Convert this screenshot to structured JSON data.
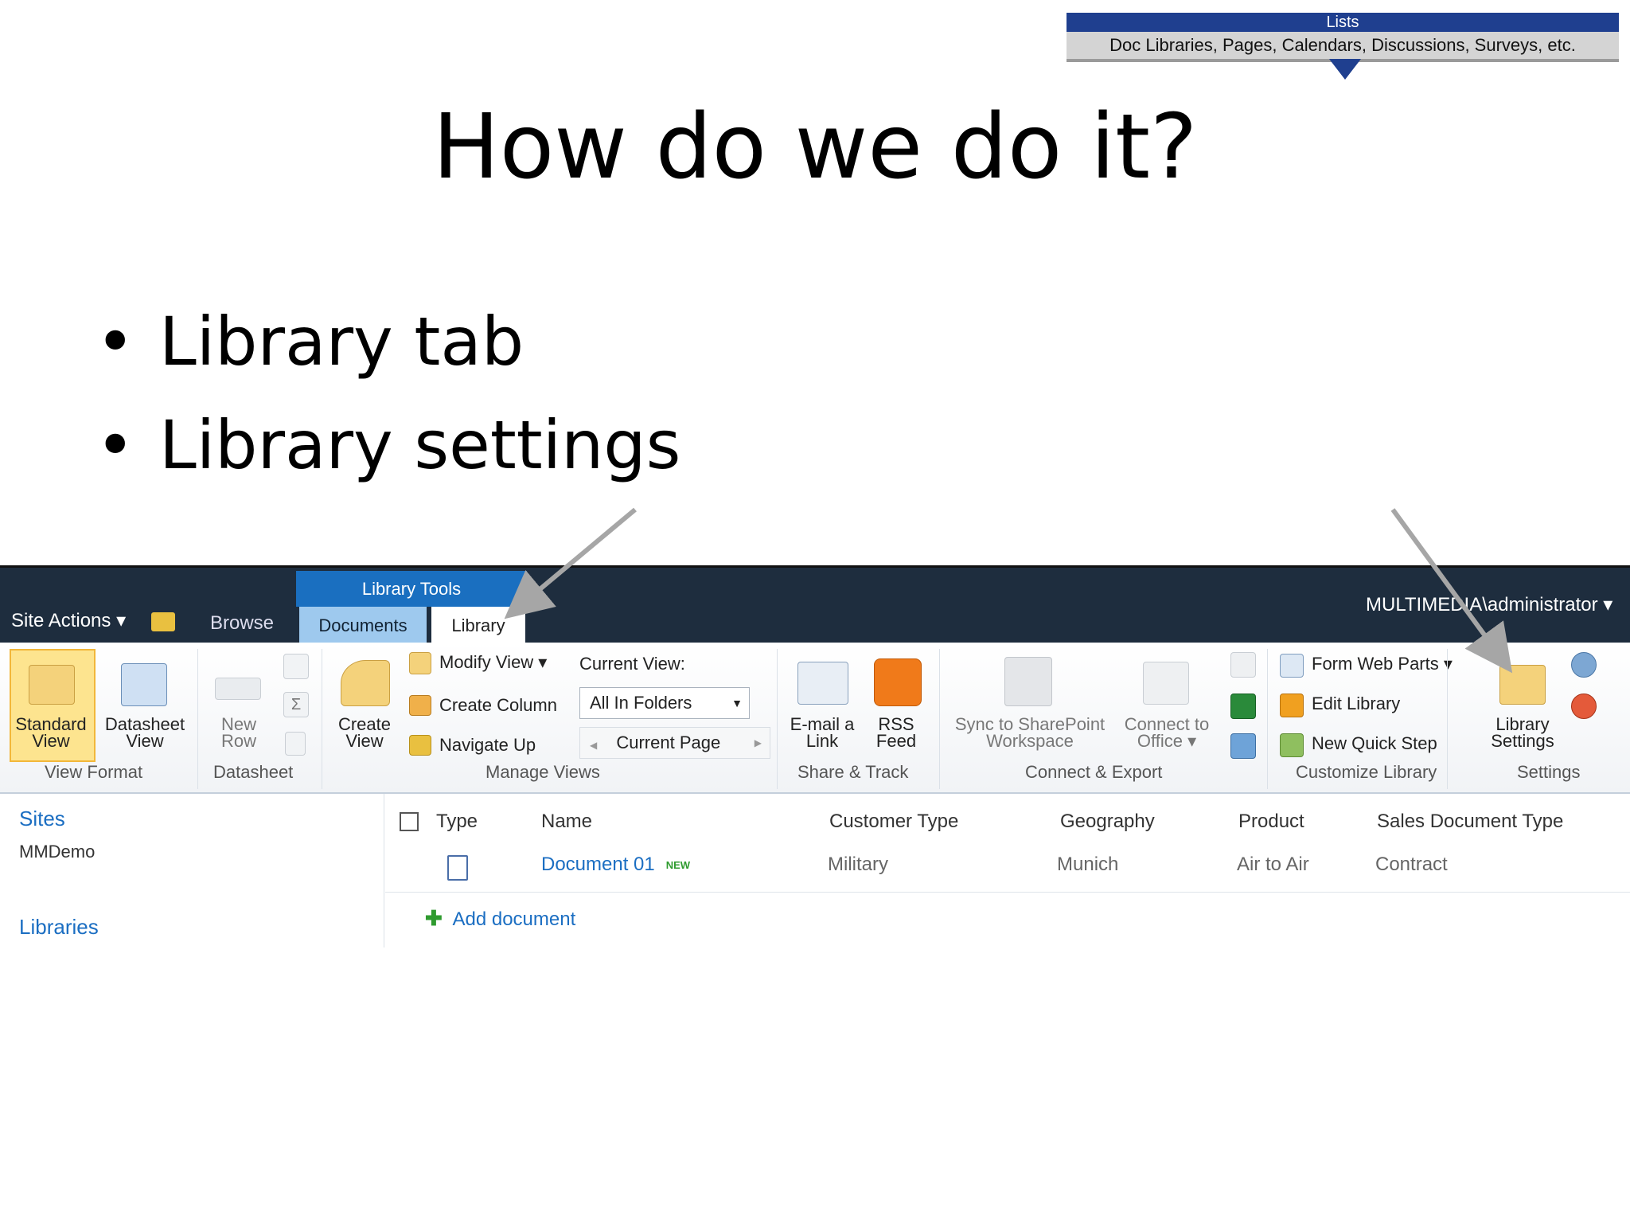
{
  "banner": {
    "title": "Lists",
    "subtitle": "Doc Libraries, Pages, Calendars, Discussions, Surveys, etc."
  },
  "slide": {
    "title": "How do we do it?",
    "bullets": [
      "Library tab",
      "Library settings"
    ],
    "bullet_char": "•"
  },
  "sharepoint": {
    "top_bar": {
      "site_actions": "Site Actions ▾",
      "browse": "Browse",
      "user": "MULTIMEDIA\\administrator ▾",
      "context_tab_group": "Library Tools",
      "tabs": [
        {
          "label": "Documents",
          "active": false
        },
        {
          "label": "Library",
          "active": true
        }
      ]
    },
    "ribbon": {
      "groups": {
        "view_format": "View Format",
        "datasheet": "Datasheet",
        "manage_views": "Manage Views",
        "share_track": "Share & Track",
        "connect_export": "Connect & Export",
        "customize_library": "Customize Library",
        "settings": "Settings"
      },
      "standard_view": [
        "Standard",
        "View"
      ],
      "datasheet_view": [
        "Datasheet",
        "View"
      ],
      "new_row": [
        "New",
        "Row"
      ],
      "create_view": [
        "Create",
        "View"
      ],
      "modify_view": "Modify View ▾",
      "create_column": "Create Column",
      "navigate_up": "Navigate Up",
      "current_view_label": "Current View:",
      "current_view_value": "All In Folders",
      "current_page": "Current Page",
      "email_link": [
        "E-mail a",
        "Link"
      ],
      "rss_feed": [
        "RSS",
        "Feed"
      ],
      "sync_sharepoint": [
        "Sync to SharePoint",
        "Workspace"
      ],
      "connect_office": [
        "Connect to",
        "Office ▾"
      ],
      "form_web_parts": "Form Web Parts ▾",
      "edit_library": "Edit Library",
      "new_quick_step": "New Quick Step",
      "library_settings": [
        "Library",
        "Settings"
      ]
    },
    "left_nav": {
      "sites_heading": "Sites",
      "sites_item": "MMDemo",
      "libraries_heading": "Libraries"
    },
    "table": {
      "columns": [
        "Type",
        "Name",
        "Customer Type",
        "Geography",
        "Product",
        "Sales Document Type"
      ],
      "rows": [
        {
          "name": "Document 01",
          "badge": "NEW",
          "customer_type": "Military",
          "geography": "Munich",
          "product": "Air to Air",
          "sales_document_type": "Contract"
        }
      ],
      "add_document": "Add document"
    }
  }
}
